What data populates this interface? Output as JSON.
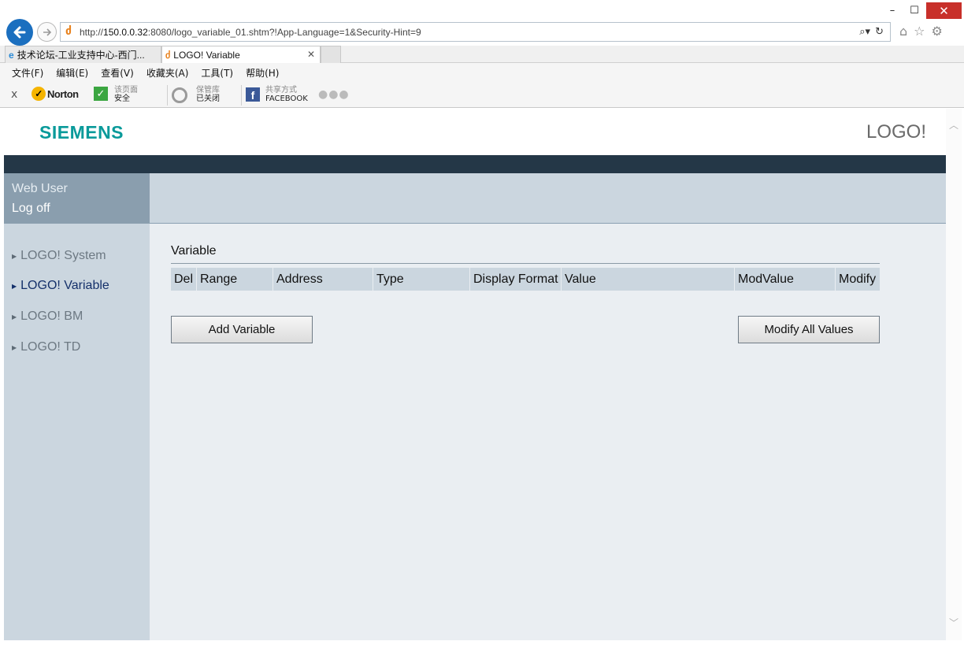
{
  "window": {
    "min_glyph": "–",
    "max_glyph": "☐",
    "close_glyph": "✕"
  },
  "addressbar": {
    "url_prefix": "http://",
    "url_host": "150.0.0.32",
    "url_rest": ":8080/logo_variable_01.shtm?!App-Language=1&Security-Hint=9"
  },
  "tabs": [
    {
      "label": "技术论坛-工业支持中心-西门...",
      "icon": "ie-icon",
      "active": false
    },
    {
      "label": "LOGO! Variable",
      "icon": "site-icon",
      "active": true
    }
  ],
  "menu": [
    "文件(F)",
    "编辑(E)",
    "查看(V)",
    "收藏夹(A)",
    "工具(T)",
    "帮助(H)"
  ],
  "toolbar": {
    "close": "x",
    "norton": "Norton",
    "page_safety_label": "该页面",
    "page_safety_value": "安全",
    "vault_label": "保管库",
    "vault_value": "已关闭",
    "share_label": "共享方式",
    "share_value": "FACEBOOK",
    "more": "●●●"
  },
  "header": {
    "brand": "SIEMENS",
    "product": "LOGO!"
  },
  "user": {
    "name": "Web User",
    "logoff": "Log off"
  },
  "sidebar": {
    "items": [
      {
        "label": "LOGO! System",
        "active": false
      },
      {
        "label": "LOGO! Variable",
        "active": true
      },
      {
        "label": "LOGO! BM",
        "active": false
      },
      {
        "label": "LOGO! TD",
        "active": false
      }
    ]
  },
  "main": {
    "title": "Variable",
    "columns": [
      "Del",
      "Range",
      "Address",
      "Type",
      "Display Format",
      "Value",
      "ModValue",
      "Modify"
    ],
    "add_button": "Add Variable",
    "modify_all_button": "Modify All Values"
  },
  "colors": {
    "brand": "#0a9a9a",
    "darkbar": "#243747",
    "panel": "#cbd6df",
    "active_nav": "#14306a"
  }
}
